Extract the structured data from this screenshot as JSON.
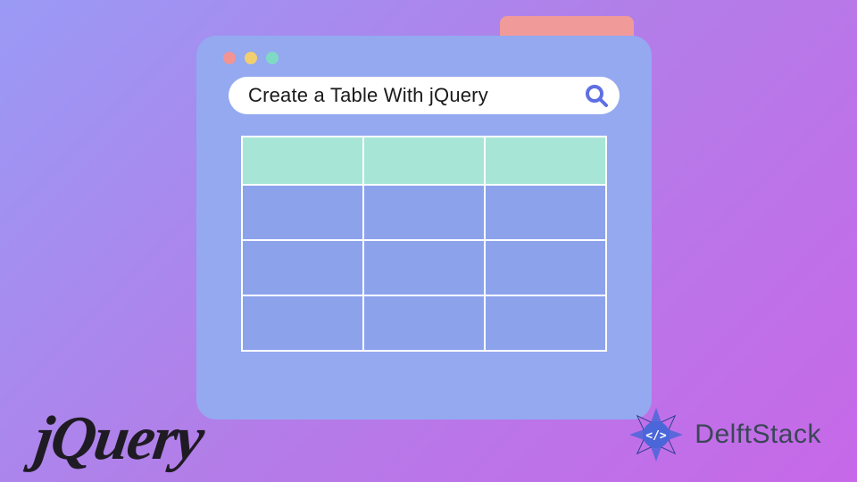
{
  "search": {
    "text": "Create a Table With jQuery"
  },
  "table": {
    "rows": 4,
    "cols": 3
  },
  "logos": {
    "jquery": "jQuery",
    "delft": "DelftStack"
  },
  "colors": {
    "window_bg": "#94a9f0",
    "header_cell": "#a7e6d6",
    "body_cell": "#8ca3ec",
    "pink_tab": "#f19a9a"
  }
}
